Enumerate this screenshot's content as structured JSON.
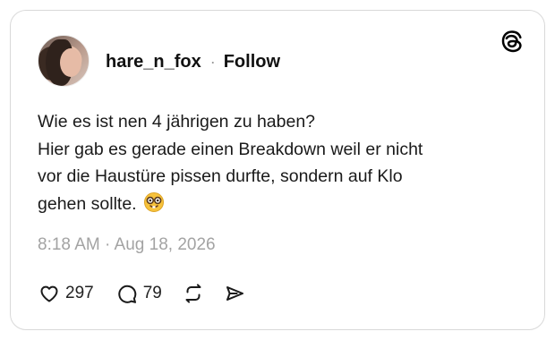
{
  "post": {
    "username": "hare_n_fox",
    "separator": "·",
    "follow_label": "Follow",
    "lines": [
      "Wie es ist nen 4 jährigen zu haben?",
      "Hier gab es gerade einen Breakdown weil er nicht",
      "vor die Haustüre pissen durfte, sondern auf Klo",
      "gehen sollte."
    ],
    "emoji": "nerd-face-emoji",
    "timestamp": "8:18 AM · Aug 18, 2026",
    "likes": "297",
    "replies": "79"
  },
  "icons": {
    "brand": "threads-logo-icon",
    "like": "heart-icon",
    "reply": "comment-icon",
    "repost": "repost-icon",
    "share": "send-icon"
  },
  "colors": {
    "text": "#1a1a1a",
    "muted": "#a3a3a3",
    "border": "#d9d9d9",
    "emoji": "#f7c23b"
  }
}
